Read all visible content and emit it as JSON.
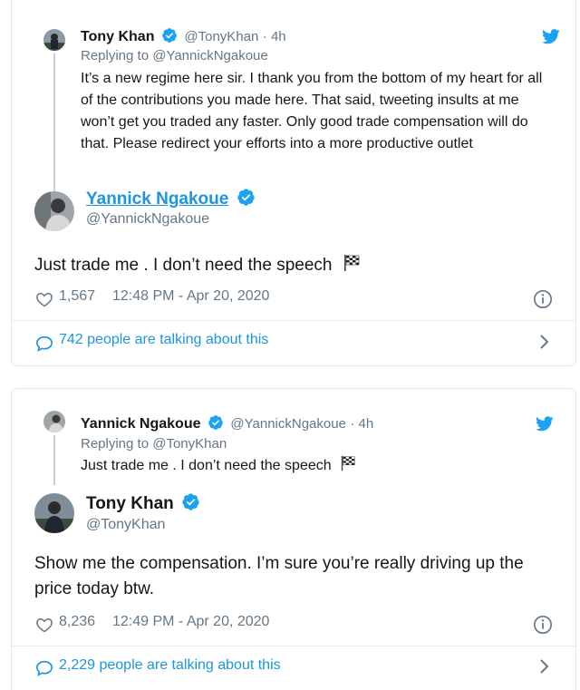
{
  "tweets": [
    {
      "quoted": {
        "name": "Tony Khan",
        "handle": "@TonyKhan",
        "time": "· 4h",
        "replying_to": "Replying to @YannickNgakoue",
        "text": "It’s a new regime here sir. I thank you from the bottom of my heart for all of the contributions you made here. That said, tweeting insults at me won’t get you traded any faster. Only good trade compensation will do that. Please redirect your efforts into a more productive outlet"
      },
      "author": {
        "name": "Yannick Ngakoue",
        "handle": "@YannickNgakoue"
      },
      "text": "Just trade me . I don’t need the speech",
      "likes": "1,567",
      "timestamp": "12:48 PM - Apr 20, 2020",
      "talking": "742 people are talking about this"
    },
    {
      "quoted": {
        "name": "Yannick Ngakoue",
        "handle": "@YannickNgakoue",
        "time": "· 4h",
        "replying_to": "Replying to @TonyKhan",
        "text": "Just trade me . I don’t need the speech"
      },
      "author": {
        "name": "Tony Khan",
        "handle": "@TonyKhan"
      },
      "text_lines": [
        "Show me the compensation. I’m sure you’re really driving up the",
        "price today btw."
      ],
      "likes": "8,236",
      "timestamp": "12:49 PM - Apr 20, 2020",
      "talking": "2,229 people are talking about this"
    }
  ],
  "icons": {
    "verified": "verified-badge-icon",
    "twitter": "twitter-bird-icon",
    "like": "heart-icon",
    "info": "info-icon",
    "comment": "comment-bubble-icon",
    "chevron": "chevron-right-icon",
    "flag": "checkered-flag-emoji"
  },
  "colors": {
    "brand_blue": "#1da1f2",
    "link_blue": "#1b95e0",
    "muted": "#657786",
    "text": "#14171a",
    "border": "#e1e8ed"
  }
}
